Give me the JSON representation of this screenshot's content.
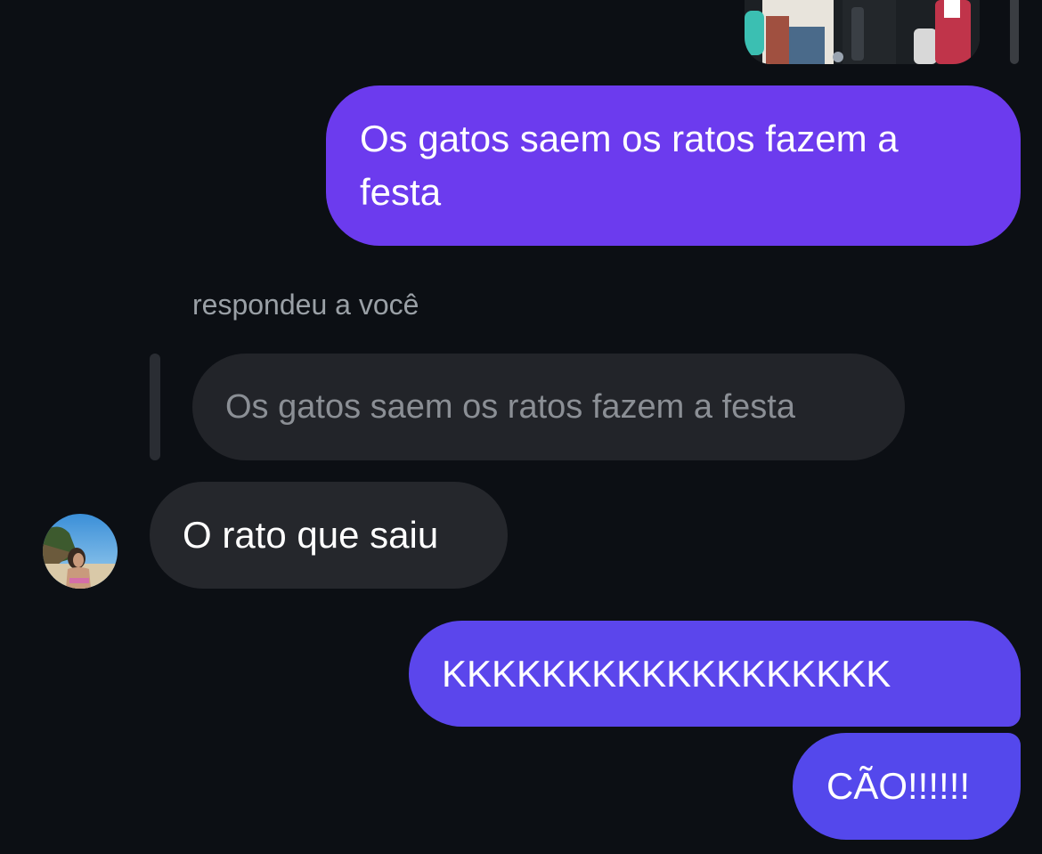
{
  "thread": {
    "shared_photo": {
      "kind": "image",
      "alt": ""
    },
    "messages": [
      {
        "direction": "outgoing",
        "text": "Os gatos saem os ratos fazem a festa"
      },
      {
        "direction": "incoming",
        "reply_label": "respondeu a você",
        "quoted_text": "Os gatos saem os ratos fazem a festa",
        "text": "O rato que saiu"
      },
      {
        "direction": "outgoing",
        "text": "KKKKKKKKKKKKKKKKKK"
      },
      {
        "direction": "outgoing",
        "text": "CÃO!!!!!!"
      }
    ]
  },
  "colors": {
    "background": "#0c0f14",
    "outgoing_purple": "#6c3bee",
    "outgoing_indigo": "#5b46ec",
    "incoming_bubble": "#25272c",
    "quoted_bubble": "#222429",
    "muted_text": "#9aa0a6"
  },
  "icons": {
    "avatar": "contact-avatar-beach-photo"
  }
}
